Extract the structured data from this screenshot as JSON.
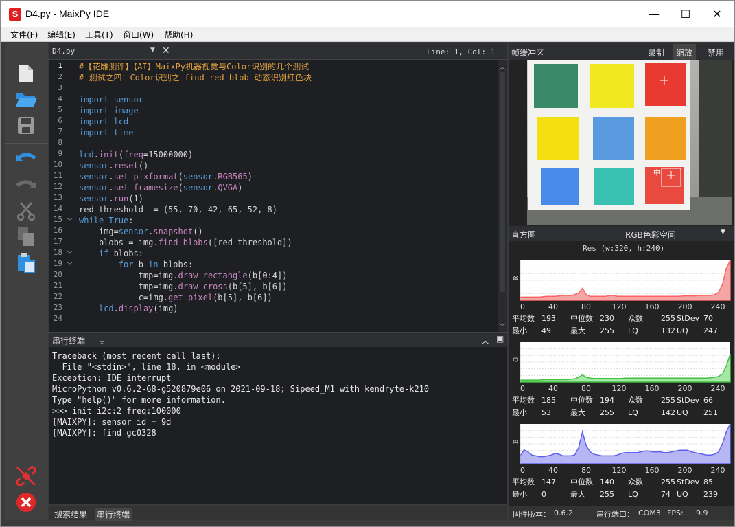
{
  "window": {
    "title": "D4.py - MaixPy IDE",
    "app_icon_letter": "S",
    "minimize": "—",
    "maximize": "☐",
    "close": "✕"
  },
  "menu": [
    "文件(F)",
    "编辑(E)",
    "工具(T)",
    "窗口(W)",
    "帮助(H)"
  ],
  "editor": {
    "tab": "D4.py",
    "cursor": "Line: 1, Col: 1",
    "line_numbers": [
      "1",
      "2",
      "3",
      "4",
      "5",
      "6",
      "7",
      "8",
      "9",
      "10",
      "11",
      "12",
      "13",
      "14",
      "15",
      "16",
      "17",
      "18",
      "19",
      "20",
      "21",
      "22",
      "23",
      "24"
    ],
    "lines": [
      "#【花雕测评】【AI】MaixPy机器视觉与Color识别的几个测试",
      "# 测试之四：Color识别之 find red blob 动态识别红色块",
      "",
      "import sensor",
      "import image",
      "import lcd",
      "import time",
      "",
      "lcd.init(freq=15000000)",
      "sensor.reset()",
      "sensor.set_pixformat(sensor.RGB565)",
      "sensor.set_framesize(sensor.QVGA)",
      "sensor.run(1)",
      "red_threshold  = (55, 70, 42, 65, 52, 8)",
      "while True:",
      "    img=sensor.snapshot()",
      "    blobs = img.find_blobs([red_threshold])",
      "    if blobs:",
      "        for b in blobs:",
      "            tmp=img.draw_rectangle(b[0:4])",
      "            tmp=img.draw_cross(b[5], b[6])",
      "            c=img.get_pixel(b[5], b[6])",
      "    lcd.display(img)",
      ""
    ]
  },
  "serial": {
    "title": "串行终端",
    "lines": [
      "Traceback (most recent call last):",
      "  File \"<stdin>\", line 18, in <module>",
      "Exception: IDE interrupt",
      "MicroPython v0.6.2-68-g520879e06 on 2021-09-18; Sipeed_M1 with kendryte-k210",
      "Type \"help()\" for more information.",
      ">>> init i2c:2 freq:100000",
      "[MAIXPY]: sensor id = 9d",
      "[MAIXPY]: find gc0328"
    ]
  },
  "bottom_tabs": [
    "搜索结果",
    "串行终端"
  ],
  "framebuffer": {
    "title": "帧缓冲区",
    "buttons": [
      "录制",
      "缩放",
      "禁用"
    ],
    "blob_label": "中"
  },
  "histogram": {
    "title": "直方图",
    "colorspace": "RGB色彩空间",
    "resolution": "Res (w:320, h:240)",
    "ticks": [
      "0",
      "40",
      "80",
      "120",
      "160",
      "200",
      "240"
    ],
    "channels": [
      {
        "name": "R",
        "color": "#ff6060",
        "fill": "#f4a6a6",
        "profile": [
          8,
          8,
          8,
          8,
          8,
          8,
          9,
          10,
          10,
          10,
          11,
          12,
          12,
          12,
          14,
          18,
          30,
          14,
          10,
          10,
          10,
          10,
          10,
          12,
          12,
          10,
          10,
          10,
          10,
          10,
          10,
          10,
          10,
          10,
          10,
          10,
          10,
          10,
          10,
          10,
          10,
          10,
          11,
          11,
          11,
          11,
          12,
          12,
          12,
          12,
          14,
          20,
          40,
          80,
          100
        ],
        "stats": {
          "mean_label": "平均数",
          "mean": "193",
          "median_label": "中位数",
          "median": "230",
          "mode_label": "众数",
          "mode": "255",
          "std_label": "StDev",
          "std": "70",
          "min_label": "最小",
          "min": "49",
          "max_label": "最大",
          "max": "255",
          "lq_label": "LQ",
          "lq": "132",
          "uq_label": "UQ",
          "uq": "247"
        }
      },
      {
        "name": "G",
        "color": "#40c040",
        "fill": "#a6e8a6",
        "profile": [
          5,
          5,
          5,
          5,
          5,
          5,
          6,
          6,
          6,
          6,
          6,
          6,
          6,
          7,
          8,
          12,
          18,
          12,
          10,
          9,
          9,
          9,
          9,
          9,
          9,
          9,
          9,
          10,
          10,
          10,
          10,
          10,
          10,
          10,
          10,
          10,
          10,
          10,
          10,
          10,
          10,
          10,
          10,
          10,
          10,
          10,
          10,
          10,
          10,
          11,
          12,
          14,
          20,
          40,
          70
        ],
        "stats": {
          "mean_label": "平均数",
          "mean": "185",
          "median_label": "中位数",
          "median": "194",
          "mode_label": "众数",
          "mode": "255",
          "std_label": "StDev",
          "std": "66",
          "min_label": "最小",
          "min": "53",
          "max_label": "最大",
          "max": "255",
          "lq_label": "LQ",
          "lq": "142",
          "uq_label": "UQ",
          "uq": "251"
        }
      },
      {
        "name": "B",
        "color": "#6060f0",
        "fill": "#b6b6f4",
        "profile": [
          20,
          35,
          30,
          22,
          20,
          18,
          18,
          20,
          22,
          26,
          24,
          20,
          20,
          20,
          22,
          40,
          80,
          45,
          30,
          24,
          22,
          20,
          20,
          20,
          20,
          22,
          26,
          28,
          28,
          28,
          28,
          30,
          32,
          32,
          30,
          30,
          30,
          28,
          28,
          30,
          32,
          34,
          34,
          34,
          30,
          28,
          26,
          24,
          22,
          22,
          24,
          30,
          50,
          80,
          100
        ],
        "stats": {
          "mean_label": "平均数",
          "mean": "147",
          "median_label": "中位数",
          "median": "140",
          "mode_label": "众数",
          "mode": "255",
          "std_label": "StDev",
          "std": "85",
          "min_label": "最小",
          "min": "0",
          "max_label": "最大",
          "max": "255",
          "lq_label": "LQ",
          "lq": "74",
          "uq_label": "UQ",
          "uq": "239"
        }
      }
    ]
  },
  "status": {
    "firmware_label": "固件版本：",
    "firmware": "0.6.2",
    "port_label": "串行端口：",
    "port": "COM3",
    "fps_label": "FPS:",
    "fps": "9.9"
  },
  "icons": [
    "new-file-icon",
    "open-folder-icon",
    "save-icon",
    "undo-icon",
    "redo-icon",
    "cut-icon",
    "copy-icon",
    "paste-icon",
    "connect-icon",
    "stop-icon"
  ]
}
